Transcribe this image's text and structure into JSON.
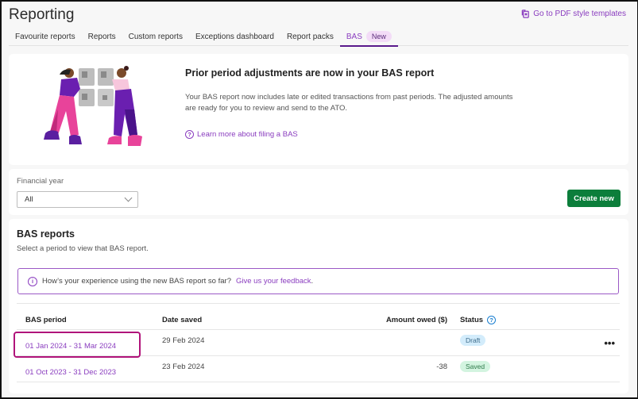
{
  "header": {
    "title": "Reporting",
    "pdf_link_label": "Go to PDF style templates"
  },
  "tabs": [
    {
      "label": "Favourite reports",
      "active": false
    },
    {
      "label": "Reports",
      "active": false
    },
    {
      "label": "Custom reports",
      "active": false
    },
    {
      "label": "Exceptions dashboard",
      "active": false
    },
    {
      "label": "Report packs",
      "active": false
    },
    {
      "label": "BAS",
      "active": true,
      "badge": "New"
    }
  ],
  "promo": {
    "title": "Prior period adjustments are now in your BAS report",
    "body": "Your BAS report now includes late or edited transactions from past periods. The adjusted amounts are ready for you to review and send to the ATO.",
    "link_label": "Learn more about filing a BAS",
    "link_icon": "question-circle-icon"
  },
  "filter": {
    "label": "Financial year",
    "selected": "All",
    "create_button": "Create new"
  },
  "list": {
    "title": "BAS reports",
    "subtitle": "Select a period to view that BAS report.",
    "feedback_text": "How’s your experience using the new BAS report so far?",
    "feedback_link": "Give us your feedback",
    "feedback_suffix": ".",
    "columns": {
      "period": "BAS period",
      "date": "Date saved",
      "amount": "Amount owed ($)",
      "status": "Status"
    },
    "rows": [
      {
        "period": "01 Jan 2024 - 31 Mar 2024",
        "date": "29 Feb 2024",
        "amount": "",
        "status": "Draft",
        "more": "•••"
      },
      {
        "period": "01 Oct 2023 - 31 Dec 2023",
        "date": "23 Feb 2024",
        "amount": "-38",
        "status": "Saved",
        "more": ""
      }
    ]
  },
  "colors": {
    "accent": "#8a3dbf",
    "tab_underline": "#5a1a8c",
    "primary_button": "#0c7e3b",
    "highlight_border": "#b0137a",
    "draft_pill": "#d3ecfb",
    "saved_pill": "#d3f4e0"
  }
}
